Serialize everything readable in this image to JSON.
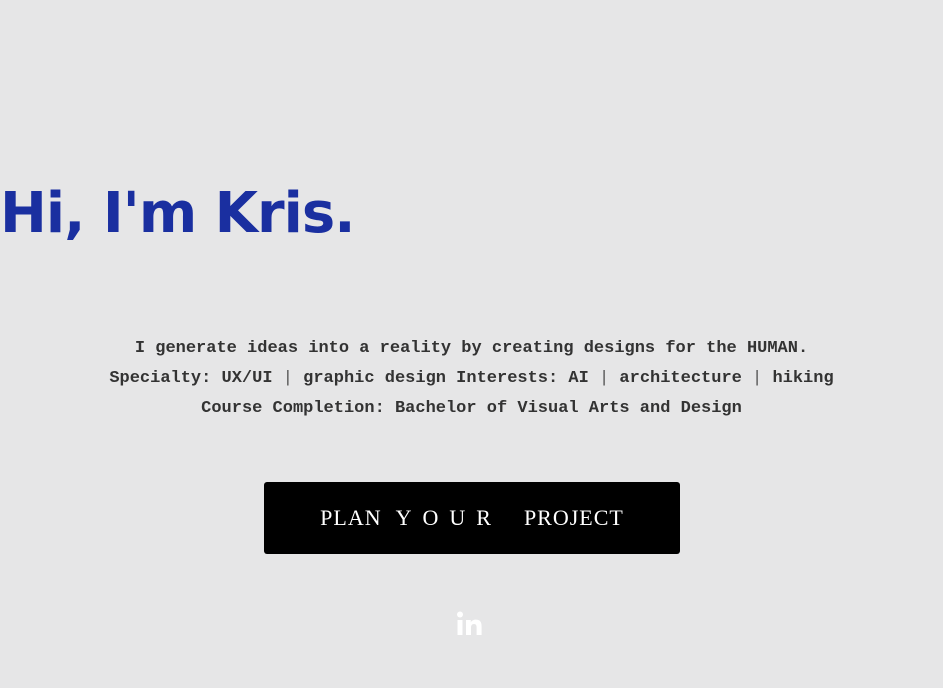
{
  "hero": {
    "title": "Hi, I'm Kris."
  },
  "bio": {
    "line1": "I generate ideas into a reality by creating designs for the HUMAN.",
    "line2": {
      "specialty_prefix": "Specialty: UX/UI",
      "separator": "|",
      "graphic_design_interests": "graphic design Interests: AI",
      "architecture": "architecture",
      "hiking": "hiking"
    },
    "line3": "Course Completion: Bachelor of Visual Arts and Design"
  },
  "cta": {
    "word1": "PLAN",
    "word2": "YOUR",
    "word3": "PROJECT"
  },
  "social": {
    "icon": "linkedin-icon"
  },
  "colors": {
    "background": "#e6e6e7",
    "accent": "#1a2fa0",
    "button": "#000000",
    "button_text": "#ffffff",
    "icon": "#ffffff"
  }
}
